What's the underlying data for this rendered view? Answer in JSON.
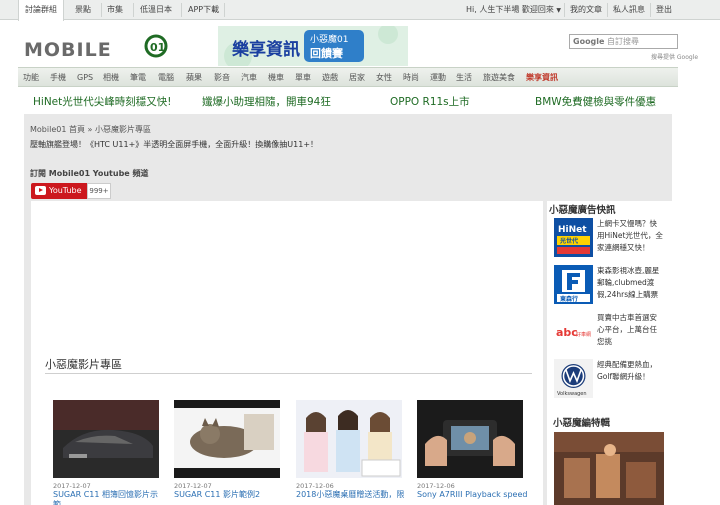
{
  "topbar": {
    "left_links": [
      "討論群組",
      "景點",
      "市集",
      "低溫日本",
      "APP下載"
    ],
    "greeting": "Hi, 人生下半場 歡迎回來",
    "right_links": [
      "我的文章",
      "私人訊息",
      "登出"
    ]
  },
  "header": {
    "logo_text": "MOBILE01",
    "banner": {
      "main": "樂享資訊",
      "badge": "小惡魔01",
      "sub": "回饋賽"
    },
    "search_brand": "Google",
    "search_placeholder": "自訂搜尋",
    "powered": "搜尋提供 Google"
  },
  "mainnav": [
    "功能",
    "手機",
    "GPS",
    "相機",
    "筆電",
    "電腦",
    "蘋果",
    "影音",
    "汽車",
    "機車",
    "單車",
    "遊戲",
    "居家",
    "女性",
    "時尚",
    "運動",
    "生活",
    "旅遊美食",
    "樂享資訊"
  ],
  "headlines": [
    "HiNet光世代尖峰時刻穩又快!",
    "孅爆小助理相隨，開車94狂",
    "OPPO R11s上市",
    "BMW免費健檢與零件優惠"
  ],
  "breadcrumb": "Mobile01 首頁 » 小惡魔影片專區",
  "description": "壓軸旗艦登場！《HTC U11+》半透明全面屏手機，全面升級！換購像抽U11+！",
  "subscribe": {
    "title": "訂閱 Mobile01 Youtube 頻道",
    "button": "YouTube",
    "count": "999+"
  },
  "section_title": "小惡魔影片專區",
  "videos": [
    {
      "date": "2017-12-07",
      "title": "SUGAR C11 相簿回憶影片示範"
    },
    {
      "date": "2017-12-07",
      "title": "SUGAR C11 影片範例2"
    },
    {
      "date": "2017-12-06",
      "title": "2018小惡魔桌曆贈送活動，限"
    },
    {
      "date": "2017-12-06",
      "title": "Sony A7RIII Playback speed"
    }
  ],
  "sidebar": {
    "title1": "小惡魔廣告快訊",
    "ads": [
      {
        "icon": "HiNet光世代",
        "text": "上網卡又慢嗎？快用HiNet光世代，全家連網穩又快！"
      },
      {
        "icon": "東森行",
        "text": "東森影視冰壺,麗星郵輪,clubmed渡假,24hrs線上購票"
      },
      {
        "icon": "abc好車網",
        "text": "買賣中古車首選安心平台，上萬台任您挑"
      },
      {
        "icon": "Volkswagen",
        "text": "經典配備更熱血，Golf聯網升級！"
      }
    ],
    "title2": "小惡魔編特輯"
  },
  "colors": {
    "brand_green": "#1f6b24",
    "accent_red": "#cc181e",
    "link_blue": "#2b6fb3"
  }
}
